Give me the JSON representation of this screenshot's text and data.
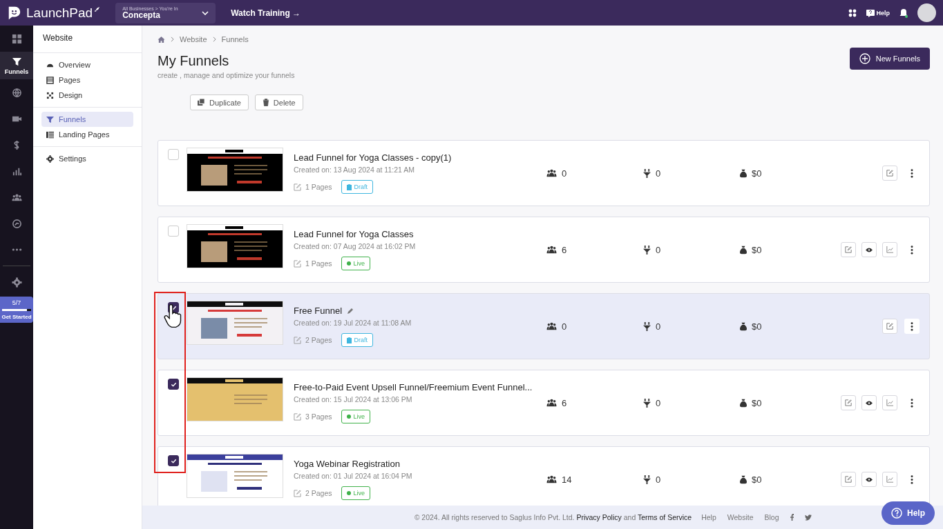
{
  "topbar": {
    "brand": "LaunchPad",
    "business_caption": "All Businesses > You're In",
    "business": "Concepta",
    "training_link": "Watch Training →",
    "help": "Help"
  },
  "rail": {
    "items": [
      {
        "selected": false
      },
      {
        "label": "Funnels",
        "selected": true
      },
      {
        "selected": false
      },
      {
        "selected": false
      },
      {
        "selected": false
      },
      {
        "selected": false
      },
      {
        "selected": false
      },
      {
        "selected": false
      },
      {
        "selected": false
      },
      {
        "selected": false
      }
    ],
    "progress": {
      "count": "5/7",
      "level": 0.86,
      "label": "Get Started"
    }
  },
  "sidebar": {
    "title": "Website",
    "groups": [
      [
        {
          "label": "Overview",
          "selected": false
        },
        {
          "label": "Pages",
          "selected": false
        },
        {
          "label": "Design",
          "selected": false
        }
      ],
      [
        {
          "label": "Funnels",
          "selected": true
        },
        {
          "label": "Landing Pages",
          "selected": false
        }
      ],
      [
        {
          "label": "Settings",
          "selected": false
        }
      ]
    ]
  },
  "breadcrumb": [
    "Website",
    "Funnels"
  ],
  "header": {
    "title": "My Funnels",
    "subtitle": "create , manage and optimize your funnels",
    "new_button": "New Funnels"
  },
  "toolbar": [
    "Duplicate",
    "Delete"
  ],
  "funnels": [
    {
      "title": "Lead Funnel for Yoga Classes - copy(1)",
      "created": "Created on: 13 Aug 2024 at 11:21 AM",
      "pages": "1 Pages",
      "status": "Draft",
      "visitors": "0",
      "conversions": "0",
      "revenue": "$0",
      "checked": false,
      "hovered": false
    },
    {
      "title": "Lead Funnel for Yoga Classes",
      "created": "Created on: 07 Aug 2024 at 16:02 PM",
      "pages": "1 Pages",
      "status": "Live",
      "visitors": "6",
      "conversions": "0",
      "revenue": "$0",
      "checked": false,
      "hovered": false
    },
    {
      "title": "Free Funnel",
      "created": "Created on: 19 Jul 2024 at 11:08 AM",
      "pages": "2 Pages",
      "status": "Draft",
      "visitors": "0",
      "conversions": "0",
      "revenue": "$0",
      "checked": true,
      "hovered": true
    },
    {
      "title": "Free-to-Paid Event Upsell Funnel/Freemium Event Funnel...",
      "created": "Created on: 15 Jul 2024 at 13:06 PM",
      "pages": "3 Pages",
      "status": "Live",
      "visitors": "6",
      "conversions": "0",
      "revenue": "$0",
      "checked": true,
      "hovered": false
    },
    {
      "title": "Yoga Webinar Registration",
      "created": "Created on: 01 Jul 2024 at 16:04 PM",
      "pages": "2 Pages",
      "status": "Live",
      "visitors": "14",
      "conversions": "0",
      "revenue": "$0",
      "checked": true,
      "hovered": false
    }
  ],
  "footer": {
    "copyright_symbol": "©",
    "copyright": "2024. All rights reserved to Saglus Info Pvt. Ltd.",
    "privacy_link": "Privacy Policy",
    "conjunction": "and",
    "terms_link": "Terms of Service",
    "links": [
      "Help",
      "Website",
      "Blog"
    ],
    "help_button": "Help"
  }
}
